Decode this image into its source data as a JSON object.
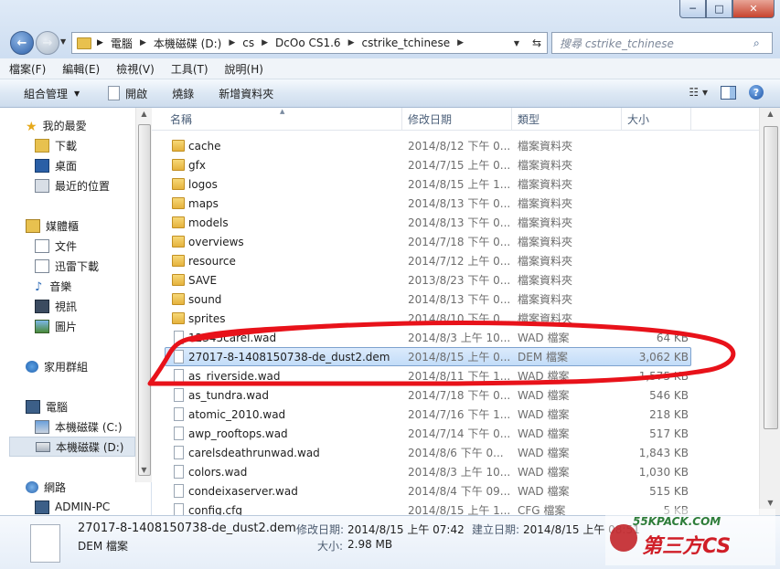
{
  "window": {
    "minimize_label": "─",
    "maximize_label": "□",
    "close_label": "✕"
  },
  "address": {
    "crumbs": [
      "電腦",
      "本機磁碟 (D:)",
      "cs",
      "DcOo CS1.6",
      "cstrike_tchinese"
    ],
    "search_placeholder": "搜尋 cstrike_tchinese"
  },
  "menubar": [
    "檔案(F)",
    "編輯(E)",
    "檢視(V)",
    "工具(T)",
    "說明(H)"
  ],
  "commandbar": {
    "organize": "組合管理",
    "open": "開啟",
    "burn": "燒錄",
    "new_folder": "新增資料夾"
  },
  "navpane": {
    "favorites": "我的最愛",
    "downloads": "下載",
    "desktop": "桌面",
    "recent": "最近的位置",
    "libraries": "媒體櫃",
    "documents": "文件",
    "thunder": "迅雷下載",
    "music": "音樂",
    "videos": "視訊",
    "pictures": "圖片",
    "homegroup": "家用群組",
    "computer": "電腦",
    "drive_c": "本機磁碟 (C:)",
    "drive_d": "本機磁碟 (D:)",
    "network": "網路",
    "admin_pc": "ADMIN-PC"
  },
  "columns": {
    "name": "名稱",
    "date": "修改日期",
    "type": "類型",
    "size": "大小"
  },
  "files": [
    {
      "name": "cache",
      "date": "2014/8/12 下午 0...",
      "type": "檔案資料夾",
      "size": "",
      "kind": "folder"
    },
    {
      "name": "gfx",
      "date": "2014/7/15 上午 0...",
      "type": "檔案資料夾",
      "size": "",
      "kind": "folder"
    },
    {
      "name": "logos",
      "date": "2014/8/15 上午 1...",
      "type": "檔案資料夾",
      "size": "",
      "kind": "folder"
    },
    {
      "name": "maps",
      "date": "2014/8/13 下午 0...",
      "type": "檔案資料夾",
      "size": "",
      "kind": "folder"
    },
    {
      "name": "models",
      "date": "2014/8/13 下午 0...",
      "type": "檔案資料夾",
      "size": "",
      "kind": "folder"
    },
    {
      "name": "overviews",
      "date": "2014/7/18 下午 0...",
      "type": "檔案資料夾",
      "size": "",
      "kind": "folder"
    },
    {
      "name": "resource",
      "date": "2014/7/12 上午 0...",
      "type": "檔案資料夾",
      "size": "",
      "kind": "folder"
    },
    {
      "name": "SAVE",
      "date": "2013/8/23 下午 0...",
      "type": "檔案資料夾",
      "size": "",
      "kind": "folder"
    },
    {
      "name": "sound",
      "date": "2014/8/13 下午 0...",
      "type": "檔案資料夾",
      "size": "",
      "kind": "folder"
    },
    {
      "name": "sprites",
      "date": "2014/8/10 下午 0...",
      "type": "檔案資料夾",
      "size": "",
      "kind": "folder"
    },
    {
      "name": "12345carel.wad",
      "date": "2014/8/3 上午 10...",
      "type": "WAD 檔案",
      "size": "64 KB",
      "kind": "file"
    },
    {
      "name": "27017-8-1408150738-de_dust2.dem",
      "date": "2014/8/15 上午 0...",
      "type": "DEM 檔案",
      "size": "3,062 KB",
      "kind": "file",
      "selected": true
    },
    {
      "name": "as_riverside.wad",
      "date": "2014/8/11 下午 1...",
      "type": "WAD 檔案",
      "size": "1,575 KB",
      "kind": "file"
    },
    {
      "name": "as_tundra.wad",
      "date": "2014/7/18 下午 0...",
      "type": "WAD 檔案",
      "size": "546 KB",
      "kind": "file"
    },
    {
      "name": "atomic_2010.wad",
      "date": "2014/7/16 下午 1...",
      "type": "WAD 檔案",
      "size": "218 KB",
      "kind": "file"
    },
    {
      "name": "awp_rooftops.wad",
      "date": "2014/7/14 下午 0...",
      "type": "WAD 檔案",
      "size": "517 KB",
      "kind": "file"
    },
    {
      "name": "carelsdeathrunwad.wad",
      "date": "2014/8/6 下午 0...",
      "type": "WAD 檔案",
      "size": "1,843 KB",
      "kind": "file"
    },
    {
      "name": "colors.wad",
      "date": "2014/8/3 上午 10...",
      "type": "WAD 檔案",
      "size": "1,030 KB",
      "kind": "file"
    },
    {
      "name": "condeixaserver.wad",
      "date": "2014/8/4 下午 09...",
      "type": "WAD 檔案",
      "size": "515 KB",
      "kind": "file"
    },
    {
      "name": "config.cfg",
      "date": "2014/8/15 上午 1...",
      "type": "CFG 檔案",
      "size": "5 KB",
      "kind": "file"
    }
  ],
  "details": {
    "filename": "27017-8-1408150738-de_dust2.dem",
    "filetype": "DEM 檔案",
    "modified_label": "修改日期:",
    "modified_value": "2014/8/15 上午 07:42",
    "created_label": "建立日期:",
    "created_value": "2014/8/15 上午 08:51",
    "size_label": "大小:",
    "size_value": "2.98 MB"
  },
  "watermark": {
    "line1": "55KPACK.COM",
    "line2": "第三方CS"
  },
  "colors": {
    "annotation_red": "#e8121a",
    "selection": "#c2dcf8"
  }
}
